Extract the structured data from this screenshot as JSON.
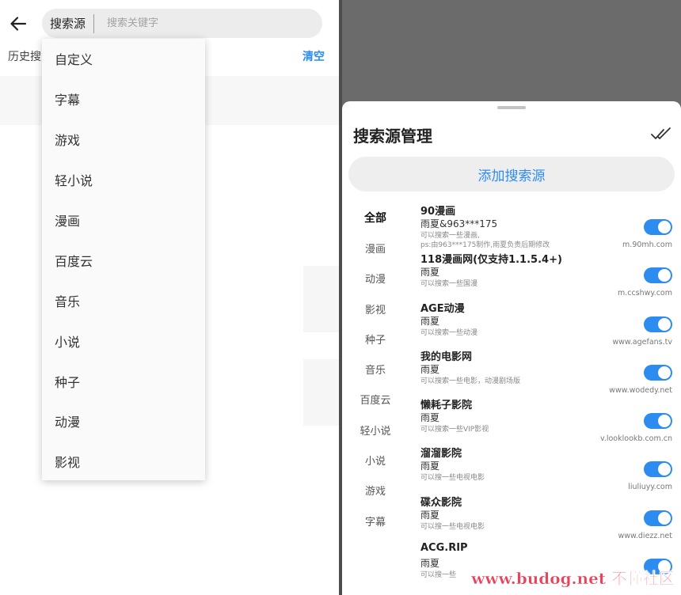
{
  "left": {
    "search": {
      "source_label": "搜索源",
      "placeholder": "搜索关键字",
      "value": ""
    },
    "history_label": "历史搜",
    "clear_label": "清空",
    "dropdown_items": [
      "自定义",
      "字幕",
      "游戏",
      "轻小说",
      "漫画",
      "百度云",
      "音乐",
      "小说",
      "种子",
      "动漫",
      "影视"
    ]
  },
  "sheet": {
    "title": "搜索源管理",
    "add_button": "添加搜索源",
    "categories": [
      "全部",
      "漫画",
      "动漫",
      "影视",
      "种子",
      "音乐",
      "百度云",
      "轻小说",
      "小说",
      "游戏",
      "字幕"
    ],
    "active_category": "全部",
    "sources": [
      {
        "name": "90漫画",
        "author": "雨夏&963***175",
        "desc": "可以搜索一些漫画,\nps:由963***175制作,雨夏负责后期修改",
        "url": "m.90mh.com",
        "enabled": true
      },
      {
        "name": "118漫画网(仅支持1.1.5.4+)",
        "author": "雨夏",
        "desc": "可以搜索一些国漫",
        "url": "m.ccshwy.com",
        "enabled": true
      },
      {
        "name": "AGE动漫",
        "author": "雨夏",
        "desc": "可以搜索一些动漫",
        "url": "www.agefans.tv",
        "enabled": true
      },
      {
        "name": "我的电影网",
        "author": "雨夏",
        "desc": "可以搜索一些电影，动漫剧场版",
        "url": "www.wodedy.net",
        "enabled": true
      },
      {
        "name": "懒耗子影院",
        "author": "雨夏",
        "desc": "可以搜索一些VIP影视",
        "url": "v.looklookb.com.cn",
        "enabled": true
      },
      {
        "name": "溜溜影院",
        "author": "雨夏",
        "desc": "可以搜一些电视电影",
        "url": "liuliuyy.com",
        "enabled": true
      },
      {
        "name": "碟众影院",
        "author": "雨夏",
        "desc": "可以搜一些电视电影",
        "url": "www.diezz.net",
        "enabled": true
      },
      {
        "name": "ACG.RIP",
        "author": "雨夏",
        "desc": "可以搜一些",
        "url": "",
        "enabled": true
      }
    ]
  },
  "watermark": "www.budog.net 不懂社区",
  "colors": {
    "accent": "#2d8cf0",
    "toggle_on": "#2d8cf0",
    "overlay": "#6b6b6b"
  }
}
